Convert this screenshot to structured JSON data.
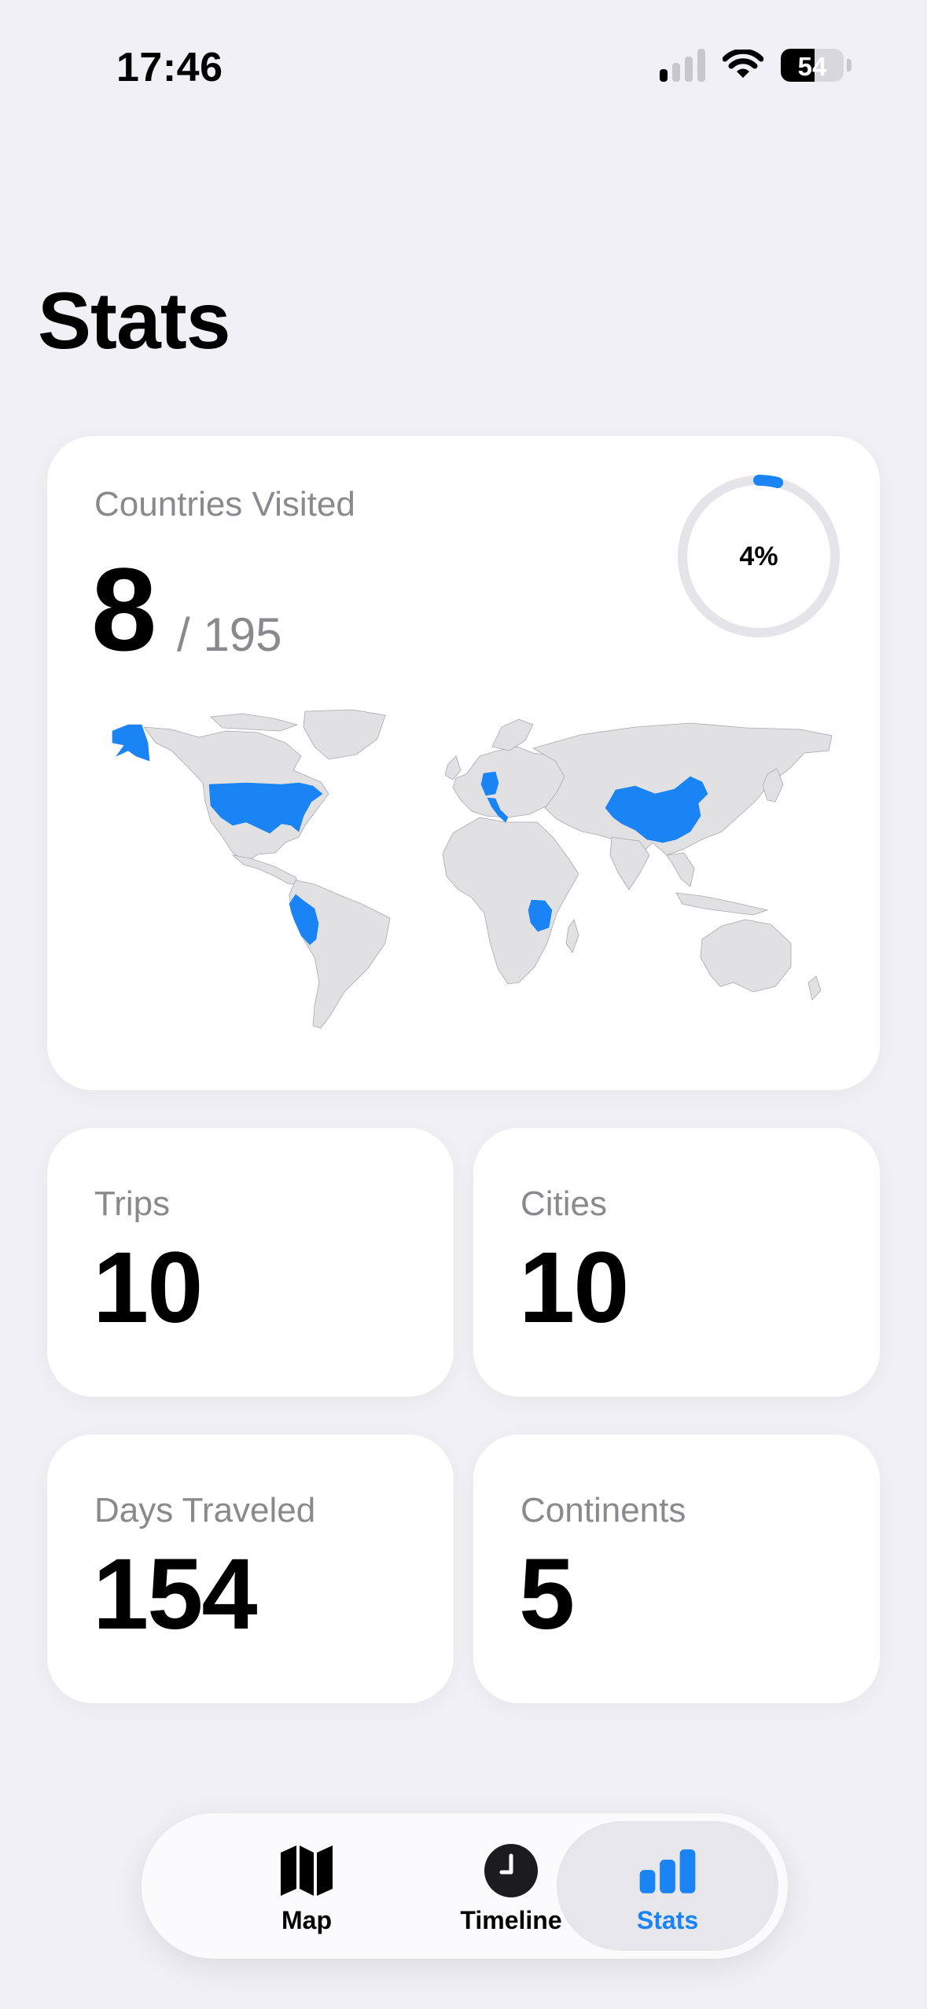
{
  "status_bar": {
    "time": "17:46",
    "battery": "54",
    "battery_level": 0.54
  },
  "page": {
    "title": "Stats"
  },
  "countries_card": {
    "label": "Countries Visited",
    "count": "8",
    "total": "/ 195",
    "progress_label": "4%",
    "progress_fraction": 0.04,
    "accent_color": "#1a84f5",
    "visited_countries": [
      "United States",
      "Peru",
      "Germany",
      "Italy",
      "Tanzania",
      "China"
    ]
  },
  "stats": {
    "trips": {
      "label": "Trips",
      "value": "10"
    },
    "cities": {
      "label": "Cities",
      "value": "10"
    },
    "days": {
      "label": "Days Traveled",
      "value": "154"
    },
    "continents": {
      "label": "Continents",
      "value": "5"
    }
  },
  "tab_bar": {
    "tabs": [
      {
        "label": "Map",
        "icon": "map-icon"
      },
      {
        "label": "Timeline",
        "icon": "clock-icon"
      },
      {
        "label": "Stats",
        "icon": "bar-chart-icon",
        "selected": true
      }
    ],
    "selected_color": "#1a84f5"
  }
}
